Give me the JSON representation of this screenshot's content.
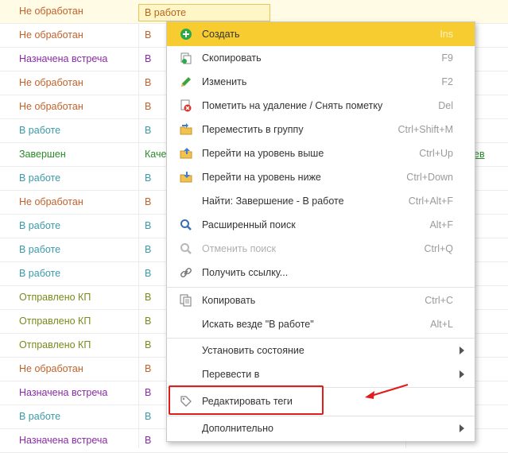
{
  "rows": [
    {
      "status": "Не обработан",
      "status_color": "#c0622b",
      "stage": "В работе",
      "stage_color": "#c0622b",
      "extra": ""
    },
    {
      "status": "Не обработан",
      "status_color": "#c0622b",
      "stage": "В",
      "stage_color": "#c0622b",
      "extra": ""
    },
    {
      "status": "Назначена встреча",
      "status_color": "#8a2aa8",
      "stage": "В",
      "stage_color": "#8a2aa8",
      "extra": ""
    },
    {
      "status": "Не обработан",
      "status_color": "#c0622b",
      "stage": "В",
      "stage_color": "#c0622b",
      "extra": ""
    },
    {
      "status": "Не обработан",
      "status_color": "#c0622b",
      "stage": "В",
      "stage_color": "#c0622b",
      "extra": ""
    },
    {
      "status": "В работе",
      "status_color": "#3a9aa8",
      "stage": "В",
      "stage_color": "#3a9aa8",
      "extra": ""
    },
    {
      "status": "Завершен",
      "status_color": "#2a8a2a",
      "stage": "Каче",
      "stage_color": "#2a8a2a",
      "extra": "ев"
    },
    {
      "status": "В работе",
      "status_color": "#3a9aa8",
      "stage": "В",
      "stage_color": "#3a9aa8",
      "extra": ""
    },
    {
      "status": "Не обработан",
      "status_color": "#c0622b",
      "stage": "В",
      "stage_color": "#c0622b",
      "extra": ""
    },
    {
      "status": "В работе",
      "status_color": "#3a9aa8",
      "stage": "В",
      "stage_color": "#3a9aa8",
      "extra": ""
    },
    {
      "status": "В работе",
      "status_color": "#3a9aa8",
      "stage": "В",
      "stage_color": "#3a9aa8",
      "extra": ""
    },
    {
      "status": "В работе",
      "status_color": "#3a9aa8",
      "stage": "В",
      "stage_color": "#3a9aa8",
      "extra": ""
    },
    {
      "status": "Отправлено КП",
      "status_color": "#7a8a1a",
      "stage": "В",
      "stage_color": "#7a8a1a",
      "extra": ""
    },
    {
      "status": "Отправлено КП",
      "status_color": "#7a8a1a",
      "stage": "В",
      "stage_color": "#7a8a1a",
      "extra": ""
    },
    {
      "status": "Отправлено КП",
      "status_color": "#7a8a1a",
      "stage": "В",
      "stage_color": "#7a8a1a",
      "extra": ""
    },
    {
      "status": "Не обработан",
      "status_color": "#c0622b",
      "stage": "В",
      "stage_color": "#c0622b",
      "extra": ""
    },
    {
      "status": "Назначена встреча",
      "status_color": "#8a2aa8",
      "stage": "В",
      "stage_color": "#8a2aa8",
      "extra": ""
    },
    {
      "status": "В работе",
      "status_color": "#3a9aa8",
      "stage": "В",
      "stage_color": "#3a9aa8",
      "extra": ""
    },
    {
      "status": "Назначена встреча",
      "status_color": "#8a2aa8",
      "stage": "В",
      "stage_color": "#8a2aa8",
      "extra": ""
    }
  ],
  "menu": {
    "create": {
      "label": "Создать",
      "shortcut": "Ins",
      "icon": "plus-circle-icon"
    },
    "copy_item": {
      "label": "Скопировать",
      "shortcut": "F9",
      "icon": "copy-document-icon"
    },
    "edit": {
      "label": "Изменить",
      "shortcut": "F2",
      "icon": "pencil-icon"
    },
    "mark_delete": {
      "label": "Пометить на удаление / Снять пометку",
      "shortcut": "Del",
      "icon": "delete-mark-icon"
    },
    "move_group": {
      "label": "Переместить в группу",
      "shortcut": "Ctrl+Shift+M",
      "icon": "move-to-folder-icon"
    },
    "level_up": {
      "label": "Перейти на уровень выше",
      "shortcut": "Ctrl+Up",
      "icon": "folder-up-icon"
    },
    "level_down": {
      "label": "Перейти на уровень ниже",
      "shortcut": "Ctrl+Down",
      "icon": "folder-down-icon"
    },
    "find": {
      "label": "Найти: Завершение - В работе",
      "shortcut": "Ctrl+Alt+F"
    },
    "advanced_search": {
      "label": "Расширенный поиск",
      "shortcut": "Alt+F",
      "icon": "magnifier-icon"
    },
    "cancel_search": {
      "label": "Отменить поиск",
      "shortcut": "Ctrl+Q",
      "icon": "magnifier-cancel-icon"
    },
    "get_link": {
      "label": "Получить ссылку...",
      "icon": "link-icon"
    },
    "copy": {
      "label": "Копировать",
      "shortcut": "Ctrl+C",
      "icon": "clipboard-copy-icon"
    },
    "search_everywhere": {
      "label": "Искать везде \"В работе\"",
      "shortcut": "Alt+L"
    },
    "set_state": {
      "label": "Установить состояние"
    },
    "convert_to": {
      "label": "Перевести в"
    },
    "edit_tags": {
      "label": "Редактировать теги",
      "icon": "tag-icon"
    },
    "more": {
      "label": "Дополнительно"
    }
  },
  "colors": {
    "menu_highlight": "#f7cc30",
    "annotation": "#e21b1b"
  }
}
